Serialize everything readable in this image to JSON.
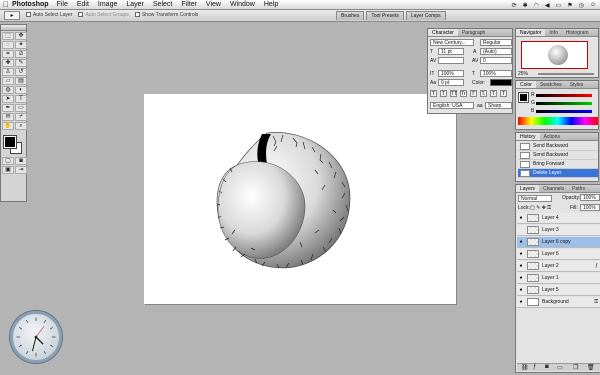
{
  "menubar": {
    "apple": "",
    "app": "Photoshop",
    "items": [
      "File",
      "Edit",
      "Image",
      "Layer",
      "Select",
      "Filter",
      "View",
      "Window",
      "Help"
    ]
  },
  "options": {
    "tool_glyph": "▸",
    "auto_select_layer": "Auto Select Layer",
    "auto_select_groups": "Auto Select Groups",
    "show_transform": "Show Transform Controls"
  },
  "palette_wells": [
    "Brushes",
    "Tool Presets",
    "Layer Comps"
  ],
  "character": {
    "tabs": [
      "Character",
      "Paragraph"
    ],
    "font": "New Century...",
    "style": "Regular",
    "size": "11 pt",
    "leading": "(Auto)",
    "tracking": "0",
    "vscale": "100%",
    "hscale": "100%",
    "baseline": "0 pt",
    "color_label": "Color:",
    "language": "English: USA",
    "aa": "Sharp",
    "aa_label": "aa",
    "style_buttons": [
      "T",
      "T",
      "TT",
      "Tr",
      "T'",
      "T,",
      "T",
      "T"
    ]
  },
  "navigator": {
    "tabs": [
      "Navigator",
      "Info",
      "Histogram"
    ],
    "zoom": "25%"
  },
  "color": {
    "tabs": [
      "Color",
      "Swatches",
      "Styles"
    ],
    "channels": [
      "R",
      "G",
      "B"
    ]
  },
  "history": {
    "tabs": [
      "History",
      "Actions"
    ],
    "items": [
      {
        "label": "Send Backward",
        "selected": false
      },
      {
        "label": "Send Backward",
        "selected": false
      },
      {
        "label": "Bring Forward",
        "selected": false
      },
      {
        "label": "Delete Layer",
        "selected": true
      }
    ]
  },
  "layers": {
    "tabs": [
      "Layers",
      "Channels",
      "Paths"
    ],
    "blend": "Normal",
    "opacity_label": "Opacity:",
    "opacity": "100%",
    "lock_label": "Lock:",
    "fill_label": "Fill:",
    "fill": "100%",
    "items": [
      {
        "name": "Layer 4",
        "visible": true,
        "selected": false
      },
      {
        "name": "Layer 3",
        "visible": false,
        "selected": false
      },
      {
        "name": "Layer 6 copy",
        "visible": true,
        "selected": true
      },
      {
        "name": "Layer 6",
        "visible": true,
        "selected": false
      },
      {
        "name": "Layer 2",
        "visible": true,
        "selected": false
      },
      {
        "name": "Layer 1",
        "visible": true,
        "selected": false
      },
      {
        "name": "Layer 5",
        "visible": true,
        "selected": false
      },
      {
        "name": "Background",
        "visible": true,
        "selected": false
      }
    ]
  },
  "colors": {
    "menubar": "#f0f0f0",
    "selection": "#3875d7",
    "layer_selection": "#9bbfe8"
  }
}
